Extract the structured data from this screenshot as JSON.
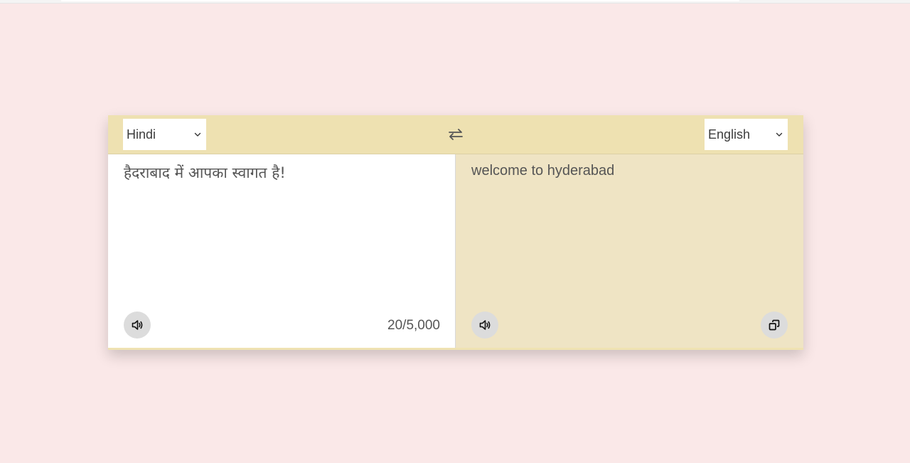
{
  "browser": {
    "top_strip": ""
  },
  "translator": {
    "from_language": {
      "selected": "Hindi",
      "icon": "chevron-down-icon"
    },
    "to_language": {
      "selected": "English",
      "icon": "chevron-down-icon"
    },
    "swap": {
      "icon": "swap-arrows-icon"
    },
    "source": {
      "text": "हैदराबाद में आपका स्वागत है!",
      "char_count": "20/5,000",
      "speak_icon": "speaker-icon"
    },
    "target": {
      "text": "welcome to hyderabad",
      "speak_icon": "speaker-icon",
      "copy_icon": "copy-icon"
    }
  },
  "colors": {
    "page_background": "#fae8e8",
    "controls_background": "#eee1b1",
    "target_background": "#efe4c4",
    "button_background": "#dcdcdc"
  }
}
